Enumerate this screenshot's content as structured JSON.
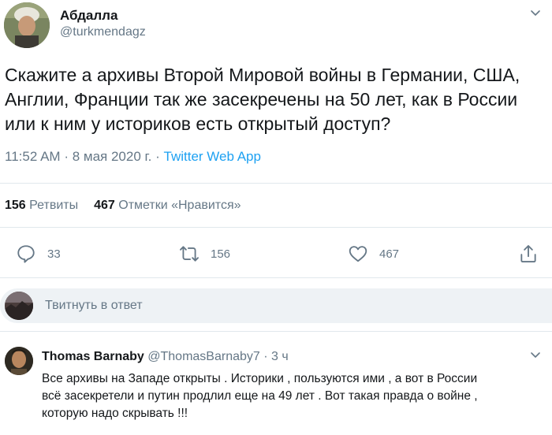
{
  "tweet": {
    "author_name": "Абдалла",
    "author_handle": "@turkmendagz",
    "text_lines": [
      "Скажите а архивы Второй Мировой войны в Германии, США,",
      "Англии, Франции так же засекречены на 50 лет, как в России",
      "или к ним у историков есть открытый доступ?"
    ],
    "time": "11:52 AM",
    "date": "8 мая 2020 г.",
    "separator": "·",
    "app": "Twitter Web App",
    "retweets_count": "156",
    "retweets_label": "Ретвиты",
    "likes_count": "467",
    "likes_label": "Отметки «Нравится»"
  },
  "actions": {
    "reply_count": "33",
    "retweet_count": "156",
    "like_count": "467"
  },
  "reply_box": {
    "placeholder": "Твитнуть в ответ"
  },
  "reply": {
    "author_name": "Thomas Barnaby",
    "author_handle": "@ThomasBarnaby7",
    "separator": "·",
    "time": "3 ч",
    "text_lines": [
      "Все архивы на Западе открыты . Историки , пользуются ими , а вот в России",
      "всё засекретели и путин продлил еще на 49 лет . Вот такая правда о войне ,",
      "которую надо скрывать !!!"
    ]
  },
  "colors": {
    "accent": "#1da1f2",
    "muted": "#657786",
    "text": "#14171a",
    "divider": "#e1e8ed"
  }
}
